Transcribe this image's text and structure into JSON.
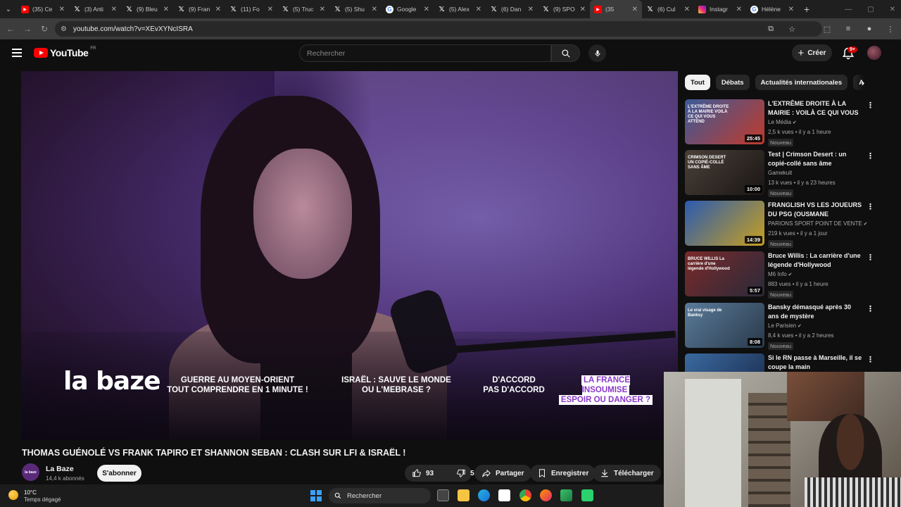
{
  "browser": {
    "tabs": [
      {
        "title": "(35) Ce",
        "type": "yt"
      },
      {
        "title": "(3) Anti",
        "type": "x"
      },
      {
        "title": "(9) Bleu",
        "type": "x"
      },
      {
        "title": "(9) Fran",
        "type": "x"
      },
      {
        "title": "(11) Fo",
        "type": "x"
      },
      {
        "title": "(5) Truc",
        "type": "x"
      },
      {
        "title": "(5) Shu",
        "type": "x"
      },
      {
        "title": "Google",
        "type": "g"
      },
      {
        "title": "(5) Alex",
        "type": "x"
      },
      {
        "title": "(6) Dan",
        "type": "x"
      },
      {
        "title": "(9) SPO",
        "type": "x"
      },
      {
        "title": "(35",
        "type": "yt",
        "active": true
      },
      {
        "title": "(6) Cul",
        "type": "x"
      },
      {
        "title": "Instagr",
        "type": "ig"
      },
      {
        "title": "Hélène",
        "type": "g"
      }
    ],
    "url": "youtube.com/watch?v=XEvXYNcISRA"
  },
  "header": {
    "logo_text": "YouTube",
    "country": "FR",
    "search_placeholder": "Rechercher",
    "create_label": "Créer",
    "notif_count": "9+"
  },
  "video": {
    "title": "THOMAS GUÉNOLÉ VS FRANK TAPIRO ET SHANNON SEBAN : CLASH SUR LFI & ISRAËL !",
    "overlay": {
      "logo": "la baze",
      "topic1": "GUERRE AU MOYEN-ORIENT TOUT COMPRENDRE EN 1 MINUTE !",
      "topic1_a": "GUERRE AU MOYEN-ORIENT",
      "topic1_b": "TOUT COMPRENDRE EN 1 MINUTE !",
      "topic2_a": "ISRAËL : SAUVE LE MONDE",
      "topic2_b": "OU L'MEBRASE ?",
      "topic3_a": "D'ACCORD",
      "topic3_b": "PAS D'ACCORD",
      "topic4_a": "LA FRANCE INSOUMISE",
      "topic4_b": "ESPOIR OU DANGER ?"
    },
    "channel": {
      "name": "La Baze",
      "subs": "14,4 k abonnés",
      "avatar_text": "la baze"
    },
    "subscribe_label": "S'abonner",
    "likes": "93",
    "dislikes": "5",
    "share_label": "Partager",
    "save_label": "Enregistrer",
    "download_label": "Télécharger"
  },
  "chips": [
    "Tout",
    "Débats",
    "Actualités internationales",
    "A"
  ],
  "recommendations": [
    {
      "title": "L'EXTRÊME DROITE À LA MAIRIE : VOILÀ CE QUI VOUS ...",
      "channel": "Le Média",
      "verified": true,
      "meta": "2,5 k vues • il y a 1 heure",
      "badge": "Nouveau",
      "duration": "25:45",
      "thumb_colors": [
        "#3a5a9a",
        "#c23a2a"
      ],
      "thumb_text": "L'EXTRÊME DROITE À LA MAIRIE VOILÀ CE QUI VOUS ATTEND"
    },
    {
      "title": "Test | Crimson Desert : un copié-collé sans âme",
      "channel": "Gamekult",
      "verified": false,
      "meta": "13 k vues • il y a 23 heures",
      "badge": "Nouveau",
      "duration": "10:00",
      "thumb_colors": [
        "#4a4038",
        "#1a1614"
      ],
      "thumb_text": "CRIMSON DESERT UN COPIÉ-COLLÉ SANS ÂME"
    },
    {
      "title": "FRANGLISH VS LES JOUEURS DU PSG (OUSMANE DEMBÉLÉ,...",
      "channel": "PARIONS SPORT POINT DE VENTE",
      "verified": true,
      "meta": "219 k vues • il y a 1 jour",
      "badge": "Nouveau",
      "duration": "14:39",
      "thumb_colors": [
        "#2a5ab0",
        "#c8a020"
      ],
      "thumb_text": ""
    },
    {
      "title": "Bruce Willis : La carrière d'une légende d'Hollywood",
      "channel": "M6 Info",
      "verified": true,
      "meta": "883 vues • il y a 1 heure",
      "badge": "Nouveau",
      "duration": "5:57",
      "thumb_colors": [
        "#7a2a2a",
        "#2a2a3a"
      ],
      "thumb_text": "BRUCE WILLIS La carrière d'une légende d'Hollywood"
    },
    {
      "title": "Bansky démasqué après 30 ans de mystère",
      "channel": "Le Parisien",
      "verified": true,
      "meta": "8,4 k vues • il y a 2 heures",
      "badge": "Nouveau",
      "duration": "8:08",
      "thumb_colors": [
        "#5a7a9a",
        "#2a3a4a"
      ],
      "thumb_text": "Le vrai visage de Banksy"
    },
    {
      "title": "Si le RN passe à Marseille, il se coupe la main",
      "channel": "",
      "verified": false,
      "meta": "",
      "badge": "",
      "duration": "",
      "thumb_colors": [
        "#3a6aa0",
        "#1a2a4a"
      ],
      "thumb_text": ""
    }
  ],
  "taskbar": {
    "temp": "10°C",
    "weather": "Temps dégagé",
    "search_label": "Rechercher"
  }
}
